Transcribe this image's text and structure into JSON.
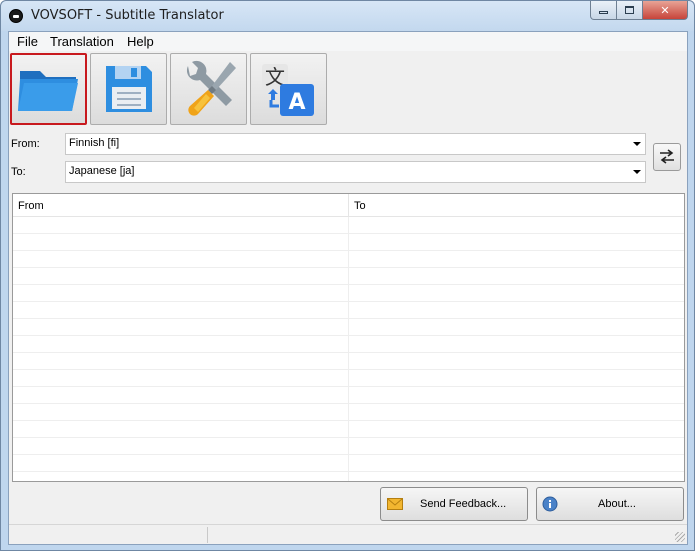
{
  "window": {
    "title": "VOVSOFT - Subtitle Translator"
  },
  "menu": [
    "File",
    "Translation",
    "Help"
  ],
  "toolbar": [
    {
      "icon": "folder-open-icon",
      "active": true
    },
    {
      "icon": "save-icon",
      "active": false
    },
    {
      "icon": "settings-icon",
      "active": false
    },
    {
      "icon": "translate-icon",
      "active": false
    }
  ],
  "from": {
    "label": "From:",
    "value": "Finnish [fi]"
  },
  "to": {
    "label": "To:",
    "value": "Japanese [ja]"
  },
  "grid": {
    "columns": [
      "From",
      "To"
    ],
    "rows": []
  },
  "buttons": {
    "feedback": "Send Feedback...",
    "about": "About..."
  },
  "colors": {
    "active_border": "#c8191e",
    "folder_blue": "#2e8ee0",
    "title_bg": "#c3d8ee"
  }
}
